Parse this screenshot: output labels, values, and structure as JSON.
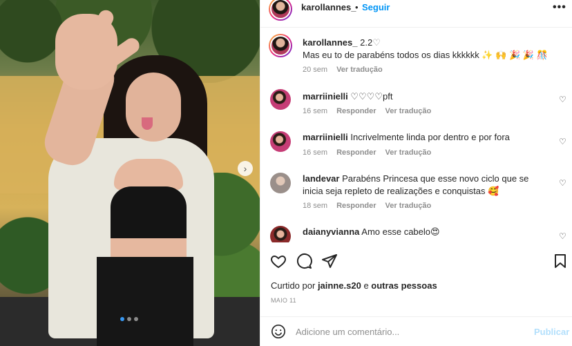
{
  "header": {
    "username": "karollannes_",
    "separator": "•",
    "follow_label": "Seguir",
    "more_icon": "more-horizontal-icon"
  },
  "caption": {
    "username": "karollannes_",
    "title": "2.2",
    "text": "Mas eu to de parabéns todos os dias kkkkkk ✨ 🙌 🎉 🎉 🎊",
    "time": "20 sem",
    "translate_label": "Ver tradução"
  },
  "comments": [
    {
      "username": "marriinielli",
      "text": "♡♡♡♡pft",
      "time": "16 sem",
      "reply_label": "Responder",
      "translate_label": "Ver tradução"
    },
    {
      "username": "marriinielli",
      "text": "Incrivelmente linda por dentro e por fora",
      "time": "16 sem",
      "reply_label": "Responder",
      "translate_label": "Ver tradução"
    },
    {
      "username": "landevar",
      "text": "Parabéns Princesa que esse novo ciclo que se inicia seja repleto de realizações e conquistas 🥰",
      "time": "18 sem",
      "reply_label": "Responder",
      "translate_label": "Ver tradução"
    },
    {
      "username": "daianyvianna",
      "text": "Amo esse cabelo😍"
    }
  ],
  "likes": {
    "prefix": "Curtido por",
    "user": "jainne.s20",
    "middle": "e",
    "suffix": "outras pessoas"
  },
  "date": "MAIO 11",
  "add_comment": {
    "placeholder": "Adicione um comentário...",
    "publish_label": "Publicar"
  },
  "colors": {
    "link_blue": "#0095f6",
    "publish_disabled": "#b2dffc",
    "muted_text": "#8e8e8e"
  },
  "carousel": {
    "current_slide": 1,
    "total_slides": 3
  }
}
